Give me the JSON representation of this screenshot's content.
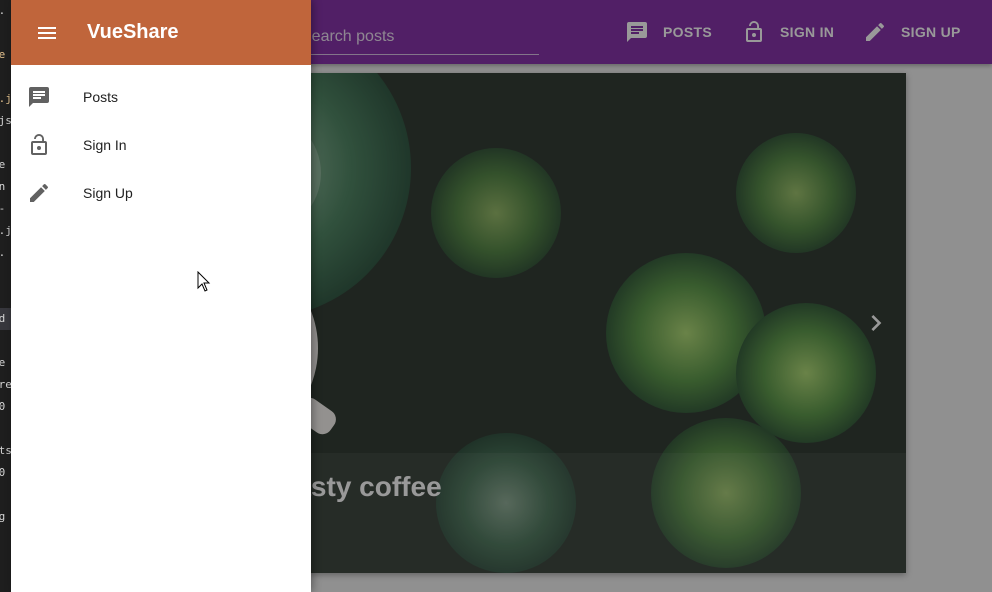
{
  "editor_strip": {
    "lines": [
      "e.",
      "s",
      "ue",
      "s",
      "s.j",
      ".js",
      "s",
      "re",
      "on",
      "e-",
      "e.j",
      "E.",
      "",
      "",
      "od",
      "",
      "se",
      "rre",
      "00",
      "0",
      "sts",
      "00",
      "0",
      "ng"
    ]
  },
  "toolbar": {
    "search_placeholder": "Search posts",
    "nav": [
      {
        "label": "POSTS",
        "icon": "chat-icon"
      },
      {
        "label": "SIGN IN",
        "icon": "lock-open-icon"
      },
      {
        "label": "SIGN UP",
        "icon": "pencil-icon"
      }
    ],
    "color": "#7b1fa2"
  },
  "carousel": {
    "caption": "Tasty coffee",
    "slide_count": 3,
    "active_slide": 1
  },
  "drawer": {
    "title": "VueShare",
    "header_color": "#c0653b",
    "items": [
      {
        "label": "Posts",
        "icon": "chat-icon"
      },
      {
        "label": "Sign In",
        "icon": "lock-open-icon"
      },
      {
        "label": "Sign Up",
        "icon": "pencil-icon"
      }
    ]
  }
}
